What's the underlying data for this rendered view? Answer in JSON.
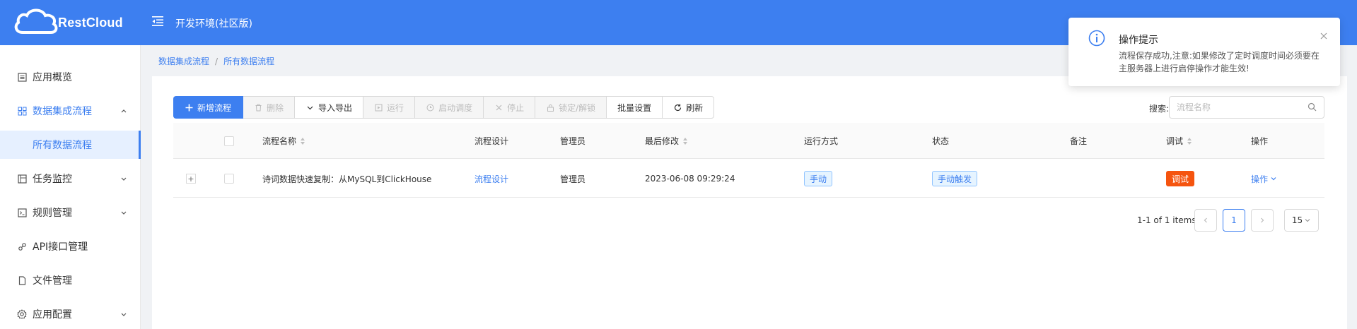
{
  "header": {
    "logo_text": "RestCloud",
    "env_title": "开发环境(社区版)"
  },
  "sidebar": {
    "items": [
      {
        "label": "应用概览",
        "icon": "overview-icon"
      },
      {
        "label": "数据集成流程",
        "icon": "grid-icon",
        "expanded": true
      },
      {
        "label": "所有数据流程",
        "selected": true
      },
      {
        "label": "任务监控",
        "icon": "monitor-icon"
      },
      {
        "label": "规则管理",
        "icon": "rules-icon"
      },
      {
        "label": "API接口管理",
        "icon": "api-icon"
      },
      {
        "label": "文件管理",
        "icon": "file-icon"
      },
      {
        "label": "应用配置",
        "icon": "settings-icon"
      }
    ]
  },
  "breadcrumb": {
    "items": [
      "数据集成流程",
      "所有数据流程"
    ],
    "separator": "/"
  },
  "toolbar": {
    "buttons": [
      {
        "label": "新增流程",
        "icon": "plus-icon",
        "state": "primary"
      },
      {
        "label": "删除",
        "icon": "trash-icon",
        "state": "disabled"
      },
      {
        "label": "导入导出",
        "icon": "chevron-down-icon",
        "state": "normal"
      },
      {
        "label": "运行",
        "icon": "run-icon",
        "state": "disabled"
      },
      {
        "label": "启动调度",
        "icon": "clock-icon",
        "state": "disabled"
      },
      {
        "label": "停止",
        "icon": "close-icon",
        "state": "disabled"
      },
      {
        "label": "锁定/解锁",
        "icon": "lock-icon",
        "state": "disabled"
      },
      {
        "label": "批量设置",
        "icon": "",
        "state": "normal"
      },
      {
        "label": "刷新",
        "icon": "refresh-icon",
        "state": "normal"
      }
    ]
  },
  "search": {
    "label": "搜索:",
    "placeholder": "流程名称",
    "value": ""
  },
  "table": {
    "columns": [
      "流程名称",
      "流程设计",
      "管理员",
      "最后修改",
      "运行方式",
      "状态",
      "备注",
      "调试",
      "操作"
    ],
    "rows": [
      {
        "name": "诗词数据快速复制：从MySQL到ClickHouse",
        "design": "流程设计",
        "admin": "管理员",
        "modified": "2023-06-08 09:29:24",
        "run_mode": "手动",
        "status": "手动触发",
        "note": "",
        "debug": "调试",
        "action": "操作"
      }
    ]
  },
  "pagination": {
    "info": "1-1 of 1 items",
    "current_page": "1",
    "page_size": "15"
  },
  "notification": {
    "title": "操作提示",
    "message": "流程保存成功,注意:如果修改了定时调度时间必须要在主服务器上进行启停操作才能生效!"
  },
  "colors": {
    "primary": "#3d7ff0",
    "danger_tag": "#f5540f",
    "sidebar_selected_bg": "#e6f0ff"
  }
}
